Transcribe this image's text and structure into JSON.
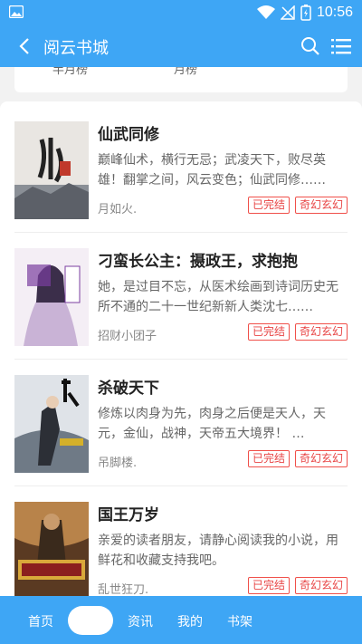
{
  "status_bar": {
    "time": "10:56"
  },
  "app_bar": {
    "title": "阅云书城"
  },
  "rank_tabs": [
    "半月榜",
    "月榜"
  ],
  "books": [
    {
      "title": "仙武同修",
      "desc": "巅峰仙术，横行无忌；武凌天下，败尽英雄！翻掌之间，风云变色；仙武同修……",
      "author": "月如火.",
      "status": "已完结",
      "genre": "奇幻玄幻"
    },
    {
      "title": "刁蛮长公主：摄政王，求抱抱",
      "desc": "她，是过目不忘，从医术绘画到诗词历史无所不通的二十一世纪新新人类沈七……",
      "author": "招财小团子",
      "status": "已完结",
      "genre": "奇幻玄幻"
    },
    {
      "title": "杀破天下",
      "desc": "修炼以肉身为先，肉身之后便是天人，天元，金仙，战神，天帝五大境界！ …",
      "author": "吊脚楼.",
      "status": "已完结",
      "genre": "奇幻玄幻"
    },
    {
      "title": "国王万岁",
      "desc": "亲爱的读者朋友，请静心阅读我的小说，用鲜花和收藏支持我吧。",
      "author": "乱世狂刀.",
      "status": "已完结",
      "genre": "奇幻玄幻"
    }
  ],
  "bottom_nav": {
    "home": "首页",
    "news": "资讯",
    "mine": "我的",
    "shelf": "书架"
  },
  "colors": {
    "primary": "#3ea6f5",
    "tag_red": "#e84545"
  }
}
